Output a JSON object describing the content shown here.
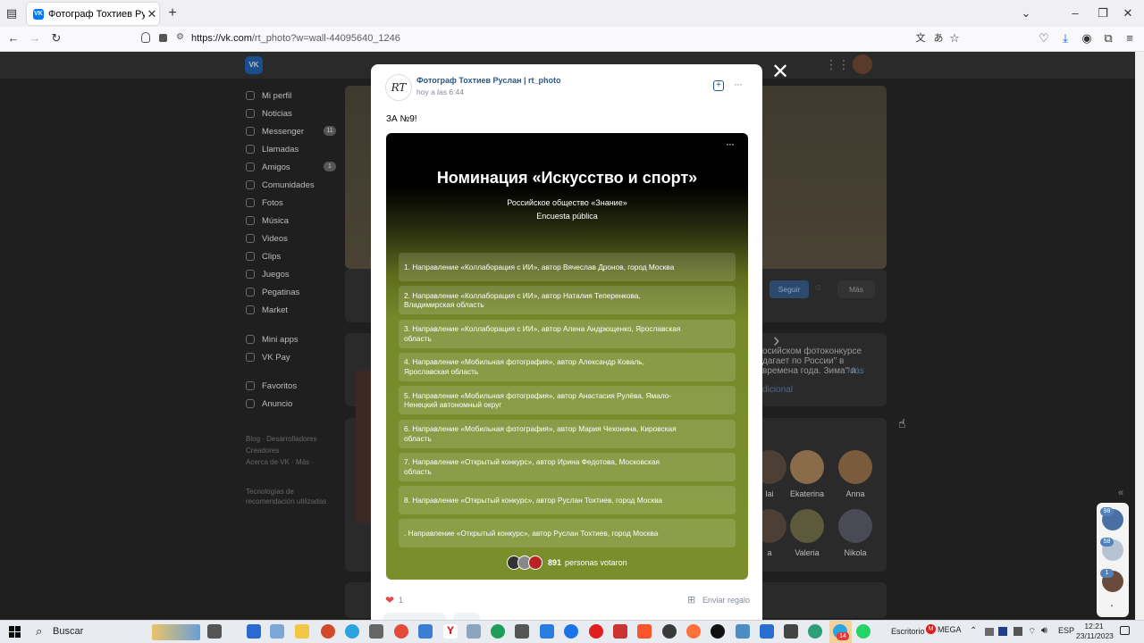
{
  "browser": {
    "tab_title": "Фотограф Тохтиев Руслан | rt_",
    "url_host": "https://vk.com",
    "url_path": "/rt_photo?w=wall-44095640_1246"
  },
  "sidebar": {
    "items": [
      {
        "label": "Mi perfil"
      },
      {
        "label": "Noticias"
      },
      {
        "label": "Messenger",
        "badge": "11"
      },
      {
        "label": "Llamadas"
      },
      {
        "label": "Amigos",
        "badge": "1"
      },
      {
        "label": "Comunidades"
      },
      {
        "label": "Fotos"
      },
      {
        "label": "Música"
      },
      {
        "label": "Videos"
      },
      {
        "label": "Clips"
      },
      {
        "label": "Juegos"
      },
      {
        "label": "Pegatinas"
      },
      {
        "label": "Market"
      },
      {
        "label": "Mini apps"
      },
      {
        "label": "VK Pay"
      },
      {
        "label": "Favoritos"
      },
      {
        "label": "Anuncio"
      }
    ],
    "footer1": "Blog · Desarrolladores",
    "footer2": "Creadores",
    "footer3": "Acerca de VK · Más ·",
    "footer4": "Tecnologías de",
    "footer5": "recomendación utilizadas"
  },
  "profile_bg": {
    "follow_button": "Seguir",
    "more_button": "Más",
    "post_text1": "осийском фотоконкурсе",
    "post_text2": "дагает по России\" в",
    "post_text3": "времена года. Зима\" и...",
    "post_more": "Más",
    "post_extra": "dicional",
    "friends_row1": [
      "lai",
      "Ekaterina",
      "Anna"
    ],
    "friends_row2": [
      "a",
      "Valeria",
      "Nikola"
    ]
  },
  "modal": {
    "author": "Фотограф Тохтиев Руслан | rt_photo",
    "time": "hoy a las 6:44",
    "post_text": "ЗА №9!",
    "poll": {
      "title": "Номинация «Искусство и спорт»",
      "subtitle": "Российское общество «Знание»",
      "poll_type": "Encuesta pública",
      "options": [
        "1. Направление «Коллаборация с ИИ», автор Вячеслав Дронов, город Москва",
        "2. Направление «Коллаборация с ИИ», автор Наталия Теперенкова, Владимирская область",
        "3. Направление «Коллаборация с ИИ», автор Алена Андрющенко, Ярославская область",
        "4. Направление «Мобильная фотография», автор Александр Коваль, Ярославская область",
        "5. Направление «Мобильная фотография», автор Анастасия Рулёва, Ямало-Ненецкий автономный округ",
        "6. Направление «Мобильная фотография», автор Мария Чехонина, Кировская область",
        "7. Направление «Открытый конкурс», автор Ирина Федотова, Московская область",
        "8. Направление «Открытый конкурс», автор Руслан Тохтиев, город Москва",
        ". Направление «Открытый конкурс», автор Руслан Тохтиев, город Москва"
      ],
      "votes_count": "891",
      "votes_label": "personas votaron"
    },
    "likes": "1",
    "gift_label": "Enviar regalo"
  },
  "dock": {
    "badge1": "98",
    "badge2": "58",
    "badge3": "1"
  },
  "taskbar": {
    "search_label": "Buscar",
    "escritorio": "Escritorio",
    "mega": "MEGA",
    "lang": "ESP",
    "time": "12:21",
    "date": "23/11/2023",
    "telegram_badge": "14"
  },
  "colors": {
    "vk_blue": "#0077ff",
    "poll_green": "#7a8f2c",
    "link_blue": "#2a5885"
  }
}
